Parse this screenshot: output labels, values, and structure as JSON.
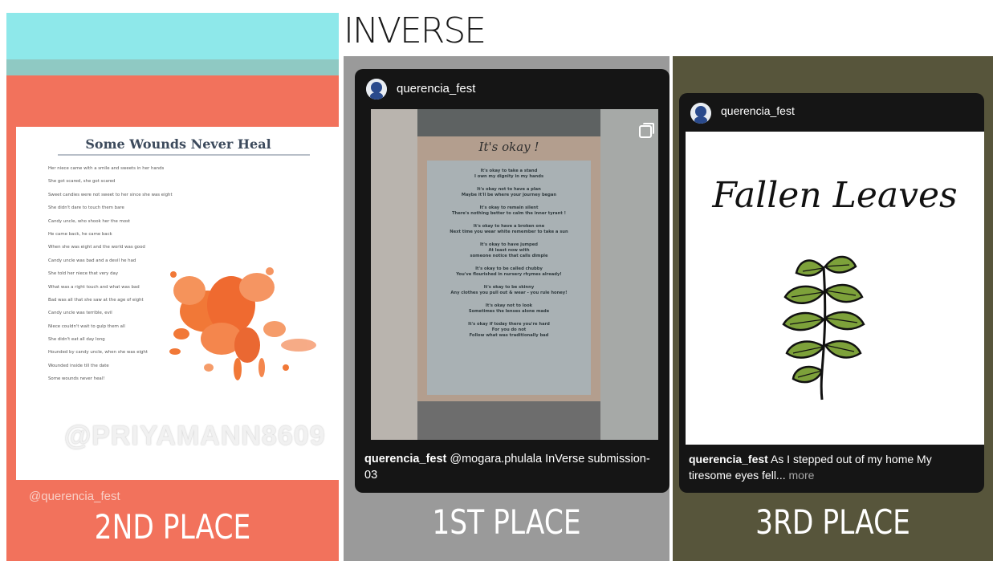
{
  "header": {
    "title": "INVERSE"
  },
  "second_place": {
    "poem_title": "Some Wounds Never Heal",
    "poem_lines": [
      "Her niece came with a smile and sweets in her hands",
      "She got scared, she got scared",
      "Sweet candies were not sweet to her since she was eight",
      "She didn't dare to touch them bare",
      "Candy uncle, who shook her the most",
      "He came back, he came back",
      "When she was eight and the world was good",
      "Candy uncle was bad and a devil he had",
      "She told her niece that very day",
      "What was a right touch and what was bad",
      "Bad was all that she saw at the age of eight",
      "Candy uncle was terrible, evil",
      "Niece couldn't wait to gulp them all",
      "She didn't eat all day long",
      "Hounded by candy uncle, when she was eight",
      "Wounded inside till the date",
      "Some wounds never heal!"
    ],
    "watermark": "@PRIYAMANN8609",
    "handle": "@querencia_fest",
    "place_label": "2ND PLACE"
  },
  "first_place": {
    "username": "querencia_fest",
    "poster_title": "It's okay !",
    "stanzas": [
      "It's okay to take a stand\nI own my dignity in my hands",
      "It's okay not to have a plan\nMaybe it'll be where your journey began",
      "It's okay to remain silent\nThere's nothing better to calm the inner tyrant !",
      "It's okay to have a broken one\nNext time you wear white remember to take a sun",
      "It's okay to have jumped\nAt least now with\nsomeone notice that calls dimple",
      "It's okay to be called chubby\nYou've flourished in nursery rhymes already!",
      "It's okay to be skinny\nAny clothes you pull out & wear - you rule honey!",
      "It's okay not to look\nSometimes the lenses alone made",
      "It's okay if today there you're hard\nFor you do not\nFollow what was traditionally bad"
    ],
    "caption_user": "querencia_fest",
    "caption_text": " @mogara.phulala  InVerse submission- 03",
    "place_label": "1ST PLACE"
  },
  "third_place": {
    "username": "querencia_fest",
    "story_title": "Fallen Leaves",
    "caption_user": "querencia_fest",
    "caption_text": " As I stepped out of my home My tiresome eyes fell...",
    "caption_more": " more",
    "place_label": "3RD PLACE"
  },
  "colors": {
    "second_bg": "#f2725c",
    "first_bg": "#9a9a9a",
    "third_bg": "#57553b",
    "leaf_green": "#7da13a"
  },
  "icons": {
    "avatar": "avatar-icon",
    "gallery": "multi-image-icon",
    "splash": "paint-splash-icon",
    "leaves": "leaf-branch-icon"
  }
}
